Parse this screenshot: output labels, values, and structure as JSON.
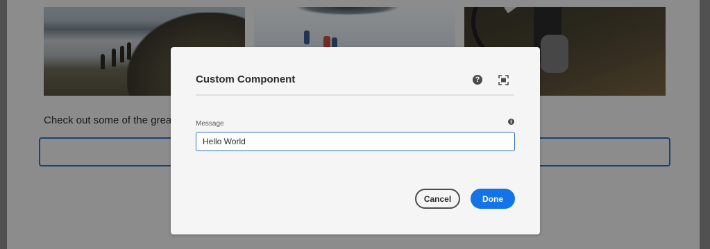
{
  "background_page": {
    "intro_text": "Check out some of the grea",
    "images": [
      "photo-hikers-lake",
      "photo-snow-climbers",
      "photo-mountain-bike"
    ]
  },
  "dialog": {
    "title": "Custom Component",
    "help_icon": "help-icon",
    "fullscreen_icon": "fullscreen-icon",
    "field": {
      "label": "Message",
      "value": "Hello World",
      "info_icon": "info-icon"
    },
    "buttons": {
      "cancel_label": "Cancel",
      "done_label": "Done"
    }
  },
  "colors": {
    "accent": "#1473e6",
    "focus_border": "#2b70c4",
    "dialog_bg": "#f5f5f5"
  }
}
